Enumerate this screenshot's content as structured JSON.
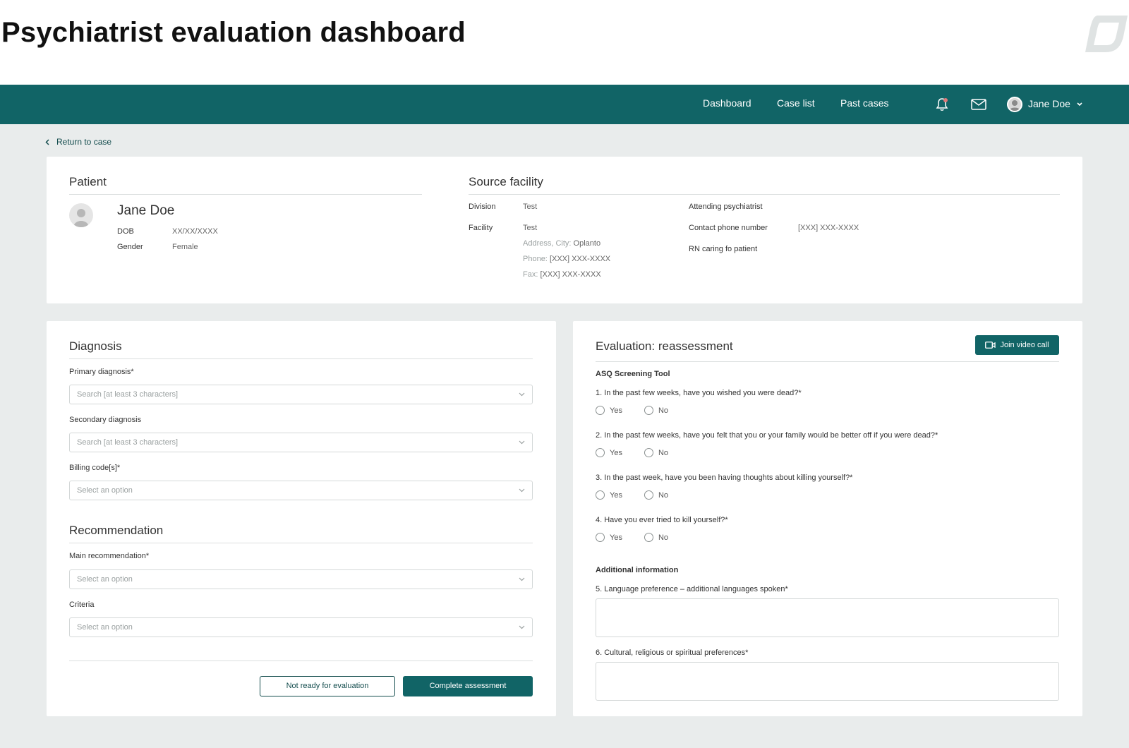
{
  "page_title": "Psychiatrist evaluation dashboard",
  "nav": {
    "links": [
      "Dashboard",
      "Case list",
      "Past cases"
    ],
    "user_name": "Jane Doe"
  },
  "return_label": "Return to case",
  "patient": {
    "section_title": "Patient",
    "name": "Jane Doe",
    "dob_label": "DOB",
    "dob_value": "XX/XX/XXXX",
    "gender_label": "Gender",
    "gender_value": "Female"
  },
  "source_facility": {
    "section_title": "Source facility",
    "division_label": "Division",
    "division_value": "Test",
    "facility_label": "Facility",
    "facility_value": "Test",
    "address_label": "Address, City:",
    "address_value": "Oplanto",
    "phone_label": "Phone:",
    "phone_value": "[XXX] XXX-XXXX",
    "fax_label": "Fax:",
    "fax_value": "[XXX] XXX-XXXX",
    "attending_label": "Attending psychiatrist",
    "contact_label": "Contact phone number",
    "contact_value": "[XXX] XXX-XXXX",
    "rn_label": "RN caring fo patient"
  },
  "diagnosis": {
    "section_title": "Diagnosis",
    "primary_label": "Primary diagnosis*",
    "primary_placeholder": "Search [at least 3 characters]",
    "secondary_label": "Secondary diagnosis",
    "secondary_placeholder": "Search [at least 3 characters]",
    "billing_label": "Billing code[s]*",
    "billing_placeholder": "Select an option"
  },
  "recommendation": {
    "section_title": "Recommendation",
    "main_label": "Main recommendation*",
    "main_placeholder": "Select an option",
    "criteria_label": "Criteria",
    "criteria_placeholder": "Select an option"
  },
  "actions": {
    "not_ready": "Not ready for evaluation",
    "complete": "Complete assessment"
  },
  "evaluation": {
    "section_title": "Evaluation: reassessment",
    "video_button": "Join video call",
    "tool_label": "ASQ Screening Tool",
    "questions": [
      "1. In the past few weeks, have you wished you were dead?*",
      "2. In the past few weeks, have you felt that you or your family would be better off if you were dead?*",
      "3. In the past week, have you been having thoughts about killing yourself?*",
      "4. Have you ever tried to kill yourself?*"
    ],
    "yes_label": "Yes",
    "no_label": "No",
    "additional_label": "Additional information",
    "q5": "5. Language preference – additional languages spoken*",
    "q6": "6. Cultural, religious or spiritual preferences*"
  },
  "colors": {
    "brand_teal": "#116466",
    "background": "#e9ecec"
  }
}
